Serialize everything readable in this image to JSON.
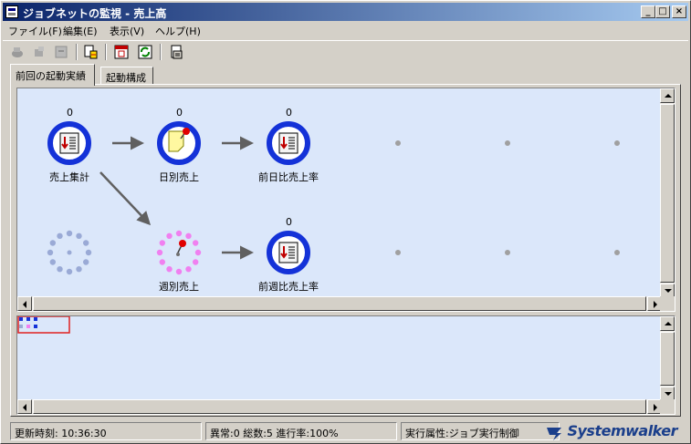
{
  "window": {
    "title": "ジョブネットの監視 - 売上高",
    "minimize": "_",
    "maximize": "□",
    "close": "×"
  },
  "menu": [
    "ファイル(F)",
    "編集(E)",
    "表示(V)",
    "ヘルプ(H)"
  ],
  "toolbar_icons": [
    "start-job-icon",
    "restart-job-icon",
    "stop-job-icon",
    "properties-icon",
    "calendar-icon",
    "refresh-icon",
    "export-icon"
  ],
  "tabs": [
    "前回の起動実績",
    "起動構成"
  ],
  "flow": {
    "nodes": [
      {
        "id": "uriage-shukei",
        "label": "売上集計",
        "count": "0",
        "type": "job"
      },
      {
        "id": "nichibetsu",
        "label": "日別売上",
        "count": "0",
        "type": "memo"
      },
      {
        "id": "zenjitsu",
        "label": "前日比売上率",
        "count": "0",
        "type": "job"
      },
      {
        "id": "empty-node",
        "label": "",
        "count": "",
        "type": "empty"
      },
      {
        "id": "shubetsu",
        "label": "週別売上",
        "count": "",
        "type": "pending-memo"
      },
      {
        "id": "zenshu",
        "label": "前週比売上率",
        "count": "0",
        "type": "job"
      }
    ],
    "colors": {
      "ring": "#1432d8",
      "pending_ring": "#f080f0",
      "empty_ring": "#9aaad6",
      "arrow": "#606060",
      "grid_dot": "#a0a0a0"
    }
  },
  "status": {
    "time": "更新時刻: 10:36:30",
    "summary": "異常:0 総数:5 進行率:100%",
    "attribute": "実行属性:ジョブ実行制御",
    "logo": "Systemwalker"
  }
}
